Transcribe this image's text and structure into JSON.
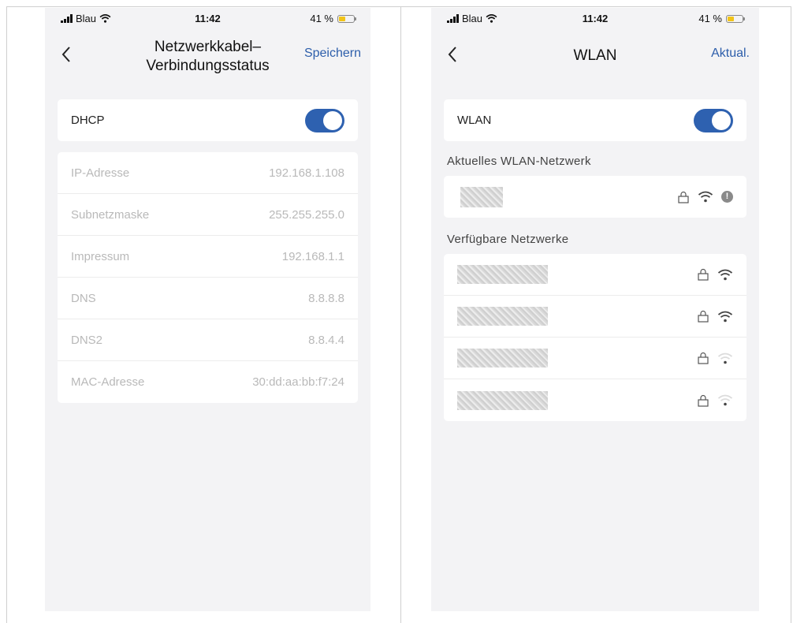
{
  "colors": {
    "accent": "#2e61b0",
    "link": "#2d5eab",
    "battery": "#f2c418",
    "background": "#f3f3f5"
  },
  "left_screen": {
    "status": {
      "carrier": "Blau",
      "time": "11:42",
      "battery": "41 %"
    },
    "nav": {
      "title_line1": "Netzwerkkabel–",
      "title_line2": "Verbindungsstatus",
      "action": "Speichern"
    },
    "dhcp": {
      "label": "DHCP",
      "enabled": true
    },
    "details": [
      {
        "label": "IP-Adresse",
        "value": "192.168.1.108"
      },
      {
        "label": "Subnetzmaske",
        "value": "255.255.255.0"
      },
      {
        "label": "Impressum",
        "value": "192.168.1.1"
      },
      {
        "label": "DNS",
        "value": "8.8.8.8"
      },
      {
        "label": "DNS2",
        "value": "8.8.4.4"
      },
      {
        "label": "MAC-Adresse",
        "value": "30:dd:aa:bb:f7:24"
      }
    ]
  },
  "right_screen": {
    "status": {
      "carrier": "Blau",
      "time": "11:42",
      "battery": "41 %"
    },
    "nav": {
      "title": "WLAN",
      "action": "Aktual."
    },
    "wlan": {
      "label": "WLAN",
      "enabled": true
    },
    "current_section": "Aktuelles WLAN-Netzwerk",
    "current_network": {
      "icons": [
        "lock-icon",
        "wifi-icon",
        "info-icon"
      ],
      "info_glyph": "!"
    },
    "available_section": "Verfügbare Netzwerke",
    "available_networks": [
      {
        "icons": [
          "lock-icon",
          "wifi-icon"
        ],
        "signal": "strong"
      },
      {
        "icons": [
          "lock-icon",
          "wifi-icon"
        ],
        "signal": "strong"
      },
      {
        "icons": [
          "lock-icon",
          "wifi-icon"
        ],
        "signal": "weak"
      },
      {
        "icons": [
          "lock-icon",
          "wifi-icon"
        ],
        "signal": "weak"
      }
    ]
  }
}
